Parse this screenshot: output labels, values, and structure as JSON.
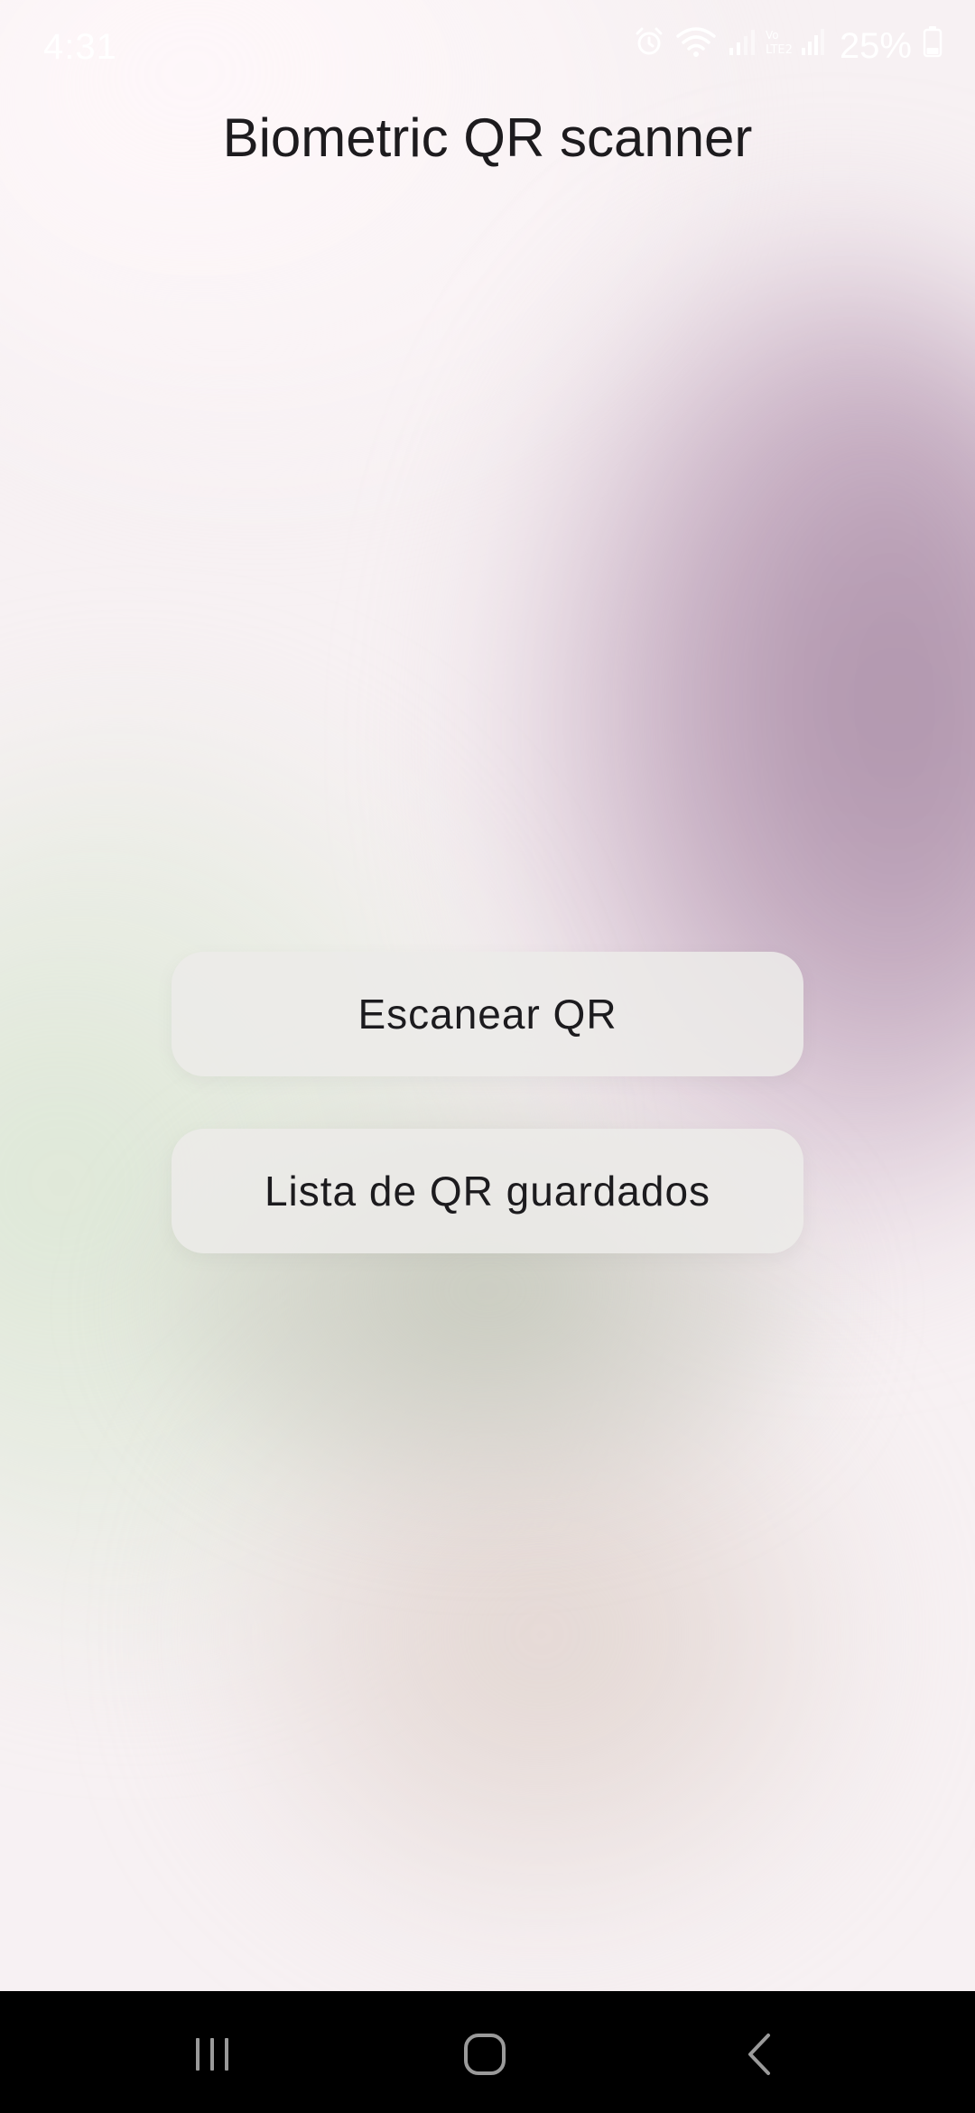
{
  "status_bar": {
    "time": "4:31",
    "battery": "25%",
    "icons": [
      "alarm-icon",
      "wifi-icon",
      "signal-icon",
      "lte-signal-icon",
      "battery-icon"
    ]
  },
  "app": {
    "title": "Biometric QR scanner"
  },
  "buttons": {
    "scan_label": "Escanear QR",
    "list_label": "Lista de QR guardados"
  },
  "nav_bar": {
    "items": [
      "recents-icon",
      "home-icon",
      "back-icon"
    ]
  },
  "colors": {
    "background_purple": "#a98ea6",
    "background_green": "#dbe6d4",
    "background_beige": "#e0d3cd",
    "button_fill": "#ecebe8",
    "text": "#1c1b1e",
    "nav_bar": "#000000"
  }
}
